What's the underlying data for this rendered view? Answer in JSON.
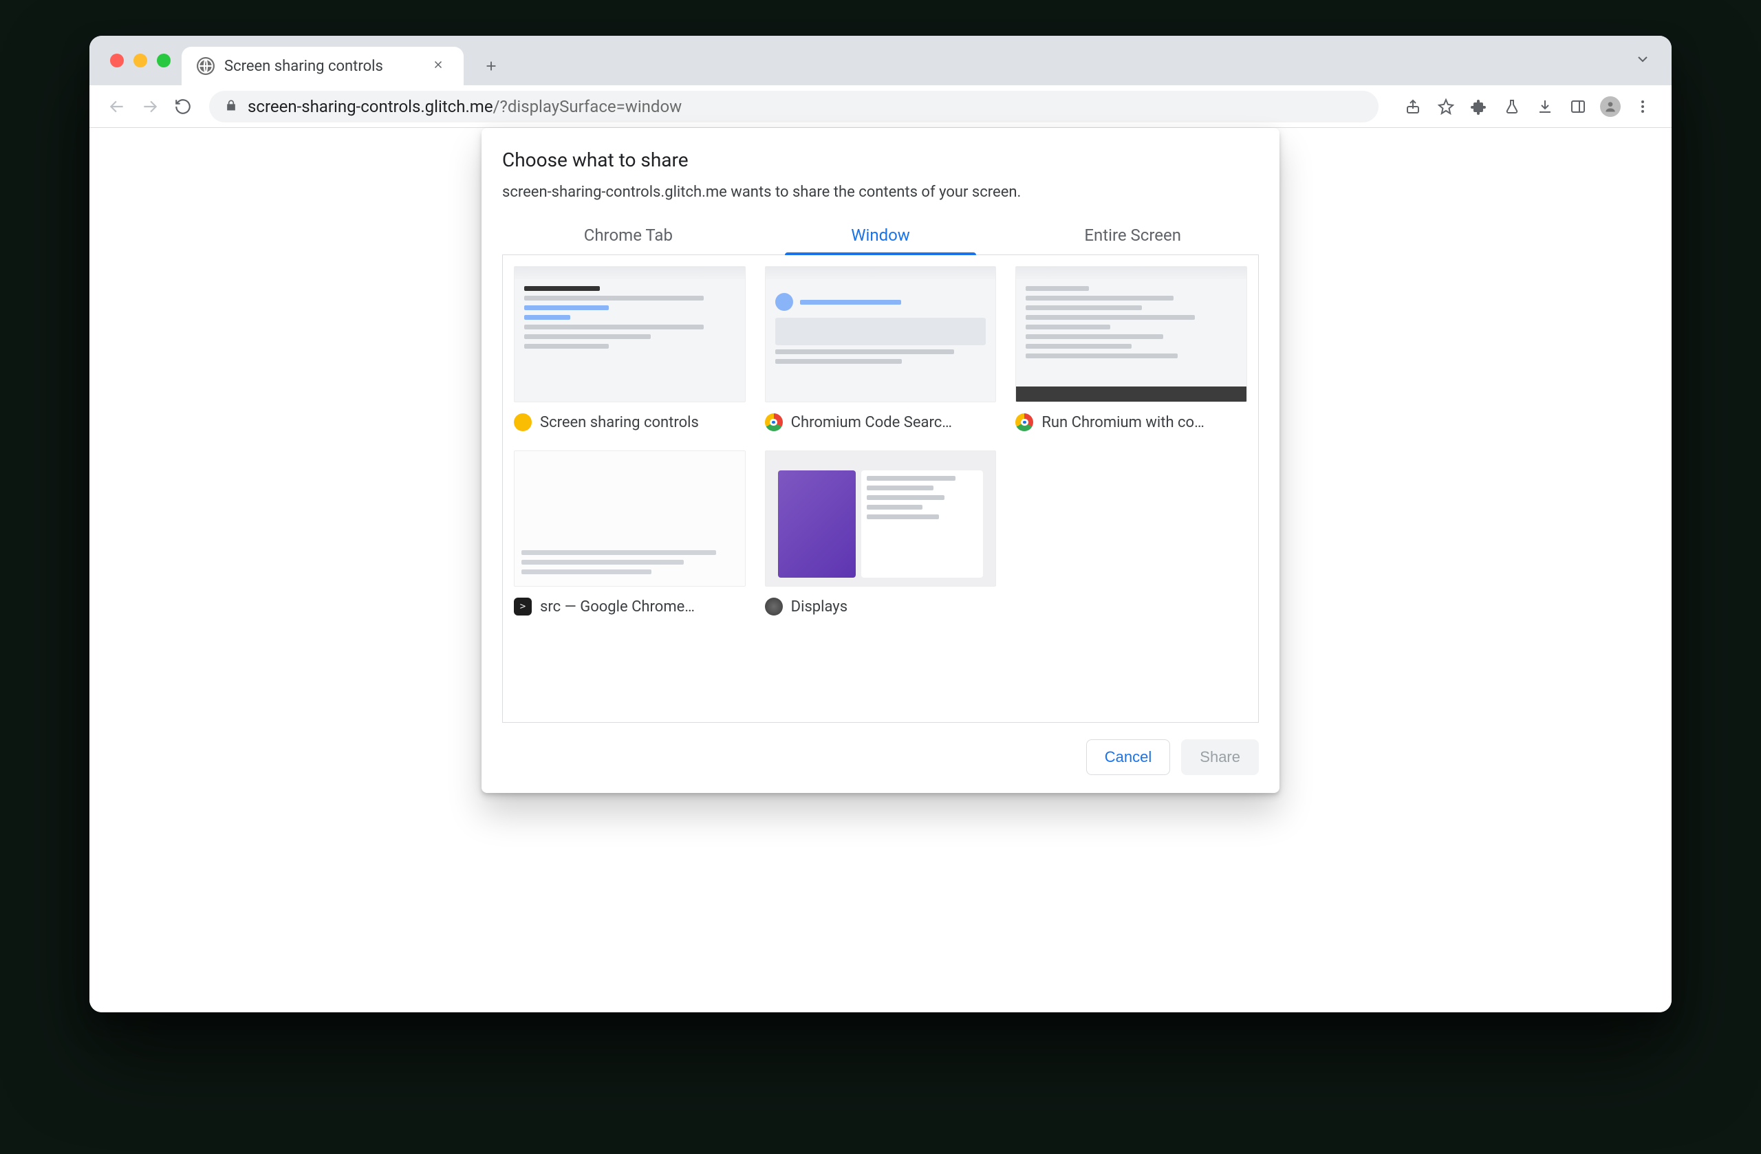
{
  "browser_tab": {
    "title": "Screen sharing controls"
  },
  "omnibox": {
    "host": "screen-sharing-controls.glitch.me",
    "path": "/?displaySurface=window"
  },
  "dialog": {
    "title": "Choose what to share",
    "subtitle": "screen-sharing-controls.glitch.me wants to share the contents of your screen.",
    "tabs": {
      "chrome_tab": "Chrome Tab",
      "window": "Window",
      "entire_screen": "Entire Screen",
      "active": "window"
    },
    "windows": [
      {
        "label": "Screen sharing controls",
        "icon": "canary"
      },
      {
        "label": "Chromium Code Searc…",
        "icon": "chrome"
      },
      {
        "label": "Run Chromium with co…",
        "icon": "chrome"
      },
      {
        "label": "src — Google Chrome…",
        "icon": "term"
      },
      {
        "label": "Displays",
        "icon": "sys"
      }
    ],
    "buttons": {
      "cancel": "Cancel",
      "share": "Share"
    }
  }
}
